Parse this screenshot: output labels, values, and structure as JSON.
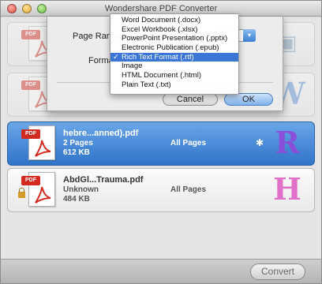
{
  "window": {
    "title": "Wondershare PDF Converter"
  },
  "files": [
    {
      "name": "",
      "pages": "",
      "size": "",
      "range": "",
      "format_icon": "image-format-icon",
      "locked": false,
      "selected": false
    },
    {
      "name": "",
      "pages": "",
      "size": "",
      "range": "",
      "format_icon": "word-format-icon",
      "locked": false,
      "selected": false
    },
    {
      "name": "hebre...anned).pdf",
      "pages": "2 Pages",
      "size": "612 KB",
      "range": "All Pages",
      "format_icon": "rtf-format-icon",
      "locked": false,
      "selected": true
    },
    {
      "name": "AbdGl...Trauma.pdf",
      "pages": "Unknown",
      "size": "484 KB",
      "range": "All Pages",
      "format_icon": "html-format-icon",
      "locked": true,
      "selected": false
    }
  ],
  "pdf_badge": "PDF",
  "settings": {
    "page_range_label": "Page Range",
    "format_label": "Format",
    "cancel_label": "Cancel",
    "ok_label": "OK"
  },
  "format_menu": {
    "items": [
      "Word Document (.docx)",
      "Excel Workbook (.xlsx)",
      "PowerPoint Presentation (.pptx)",
      "Electronic Publication (.epub)",
      "Rich Text Format (.rtf)",
      "Image",
      "HTML Document (.html)",
      "Plain Text (.txt)"
    ],
    "selected_index": 4,
    "check_mark": "✓"
  },
  "footer": {
    "convert_label": "Convert"
  },
  "colors": {
    "selection": "#3b76d6",
    "pdf_red": "#d32a20",
    "rtf_purple": "#8a4fd8",
    "html_pink": "#e070c8",
    "word_blue": "#5a8ed6"
  }
}
